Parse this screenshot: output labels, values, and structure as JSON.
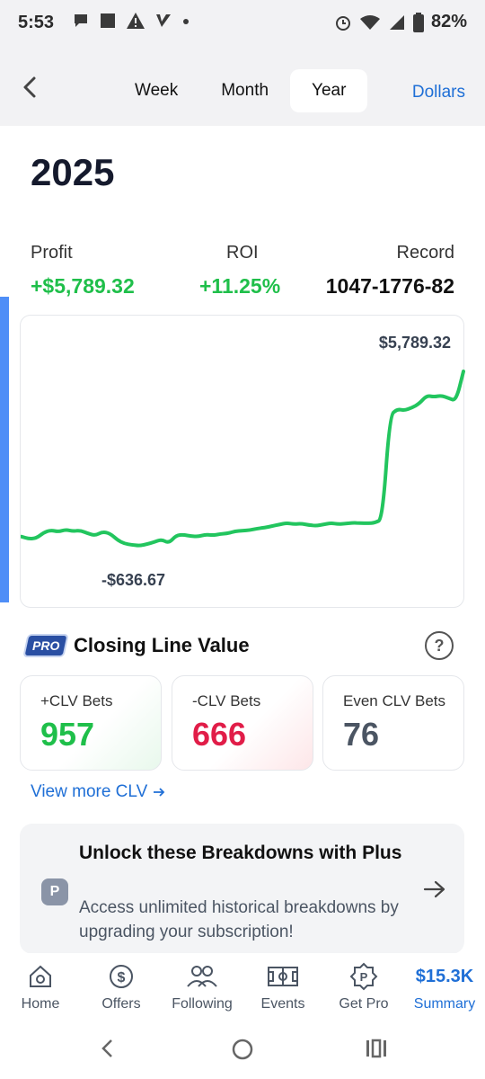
{
  "status_bar": {
    "time": "5:53",
    "battery": "82%"
  },
  "header": {
    "tabs": [
      {
        "label": "Week",
        "active": false
      },
      {
        "label": "Month",
        "active": false
      },
      {
        "label": "Year",
        "active": true
      }
    ],
    "units_label": "Dollars"
  },
  "period_title": "2025",
  "stats": {
    "profit_label": "Profit",
    "profit_value": "+$5,789.32",
    "roi_label": "ROI",
    "roi_value": "+11.25%",
    "record_label": "Record",
    "record_value": "1047-1776-82"
  },
  "chart": {
    "max_label": "$5,789.32",
    "min_label": "-$636.67"
  },
  "chart_data": {
    "type": "line",
    "series": [
      {
        "values": [
          -300,
          -380,
          -360,
          -150,
          -60,
          -120,
          -40,
          -100,
          -70,
          -180,
          -260,
          -120,
          -180,
          -420,
          -560,
          -600,
          -636.67,
          -580,
          -500,
          -400,
          -540,
          -250,
          -230,
          -280,
          -300,
          -220,
          -250,
          -200,
          -180,
          -100,
          -80,
          -60,
          0,
          30,
          90,
          150,
          200,
          160,
          180,
          130,
          100,
          150,
          200,
          160,
          180,
          210,
          200,
          190,
          210,
          350,
          4150,
          4400,
          4350,
          4450,
          4600,
          4900,
          4850,
          4900,
          4800,
          4700,
          5789.32
        ]
      }
    ]
  },
  "clv": {
    "badge": "PRO",
    "title": "Closing Line Value",
    "positive_label": "+CLV Bets",
    "positive_value": "957",
    "negative_label": "-CLV Bets",
    "negative_value": "666",
    "even_label": "Even CLV Bets",
    "even_value": "76",
    "view_more": "View more CLV",
    "colors": {
      "positive": "#1fbf4a",
      "negative": "#e11d48",
      "even": "#4b5563"
    }
  },
  "unlock": {
    "badge": "P",
    "title": "Unlock these Breakdowns with Plus",
    "description": "Access unlimited historical breakdowns by upgrading your subscription!"
  },
  "bottom_nav": {
    "items": [
      {
        "label": "Home",
        "icon": "home-icon"
      },
      {
        "label": "Offers",
        "icon": "dollar-circle-icon"
      },
      {
        "label": "Following",
        "icon": "people-icon"
      },
      {
        "label": "Events",
        "icon": "stadium-icon"
      },
      {
        "label": "Get Pro",
        "icon": "pro-badge-icon"
      },
      {
        "label": "Summary",
        "amount": "$15.3K",
        "active": true
      }
    ]
  },
  "accent_color": "#1f6fd6",
  "line_color": "#22c55e"
}
